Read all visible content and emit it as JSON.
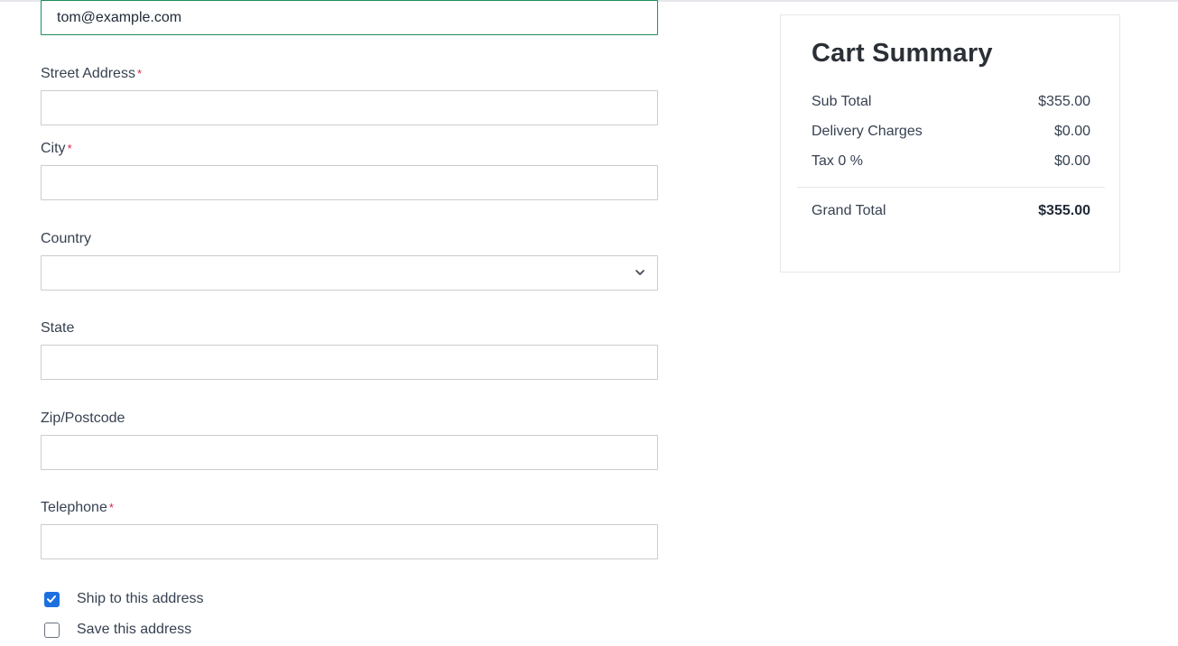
{
  "form": {
    "email": {
      "value": "tom@example.com"
    },
    "street": {
      "label": "Street Address",
      "required": "*",
      "value": ""
    },
    "city": {
      "label": "City",
      "required": "*",
      "value": ""
    },
    "country": {
      "label": "Country",
      "selected": ""
    },
    "state": {
      "label": "State",
      "value": ""
    },
    "zip": {
      "label": "Zip/Postcode",
      "value": ""
    },
    "telephone": {
      "label": "Telephone",
      "required": "*",
      "value": ""
    },
    "ship_to_address": {
      "label": "Ship to this address",
      "checked": true
    },
    "save_address": {
      "label": "Save this address",
      "checked": false
    }
  },
  "summary": {
    "title": "Cart Summary",
    "rows": [
      {
        "label": "Sub Total",
        "value": "$355.00"
      },
      {
        "label": "Delivery Charges",
        "value": "$0.00"
      },
      {
        "label": "Tax 0 %",
        "value": "$0.00"
      }
    ],
    "grand_total": {
      "label": "Grand Total",
      "value": "$355.00"
    }
  },
  "colors": {
    "focus_border": "#1d8f5a",
    "checkbox_checked": "#1d6fe0",
    "required_mark": "#e11d48"
  },
  "icons": {
    "select": "chevron-down-icon",
    "checked": "checkmark-icon"
  }
}
